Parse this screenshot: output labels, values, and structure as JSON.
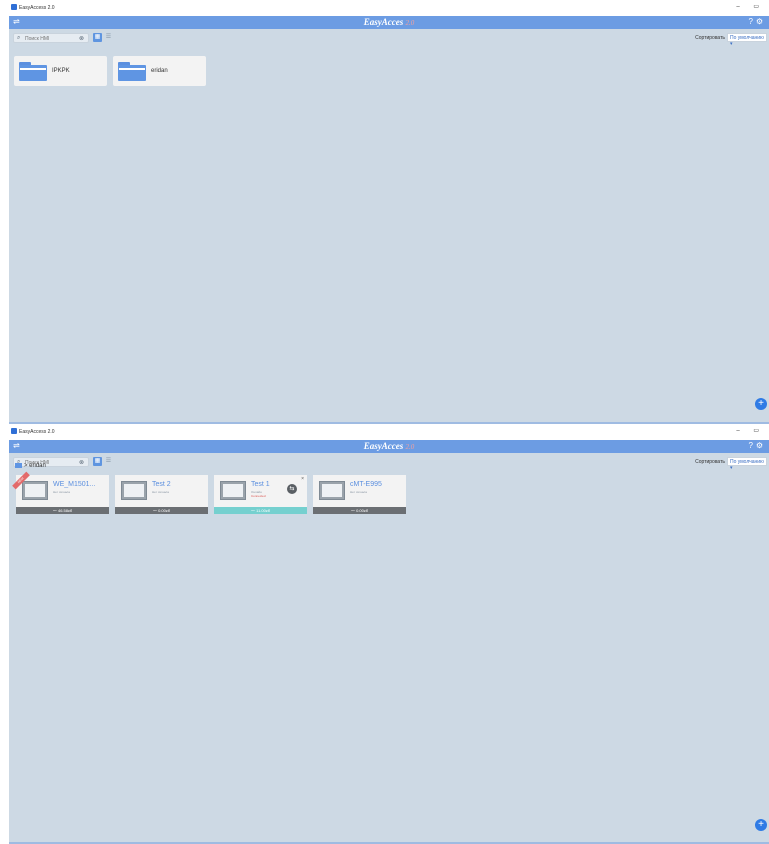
{
  "window1": {
    "titlebar": {
      "title": "EasyAccess 2.0",
      "controls": "– ▭"
    },
    "header": {
      "brand": "EasyAcces",
      "brand_suffix": "2.0"
    },
    "toolbar": {
      "search_placeholder": "Поиск HMI",
      "sort_label": "Сортировать",
      "sort_value": "По умолчанию ▾"
    },
    "folders": [
      {
        "name": "IPKPK"
      },
      {
        "name": "eridan"
      }
    ]
  },
  "window2": {
    "titlebar": {
      "title": "EasyAccess 2.0",
      "controls": "– ▭"
    },
    "header": {
      "brand": "EasyAcces",
      "brand_suffix": "2.0"
    },
    "toolbar": {
      "search_placeholder": "Поиск HMI",
      "sort_label": "Сортировать",
      "sort_value": "По умолчанию ▾"
    },
    "breadcrumb": "> eridan",
    "hmis": [
      {
        "name": "WE_M1501...",
        "status": "Нет сигнала",
        "traffic": "46.58кб",
        "ribbon": "NEW"
      },
      {
        "name": "Test 2",
        "status": "Нет сигнала",
        "traffic": "0.00кб"
      },
      {
        "name": "Test 1",
        "status": "Онлайн",
        "status2": "Connected",
        "traffic": "11.00кб"
      },
      {
        "name": "cMT-E995",
        "status": "Нет сигнала",
        "traffic": "0.00кб"
      }
    ]
  },
  "icons": {
    "connect": "⇌",
    "help": "?",
    "gear": "⚙",
    "search": "⌕",
    "clear": "⊗",
    "grid_view": "▦",
    "list_view": "☰",
    "add": "+",
    "connection": "⇆",
    "close": "×",
    "traffic": "〜"
  },
  "colors": {
    "header": "#6c9ce3",
    "background": "#cdd9e4",
    "accent": "#2f7be5",
    "traffic_active": "#75d0cf",
    "traffic_idle": "#6b6f73"
  }
}
